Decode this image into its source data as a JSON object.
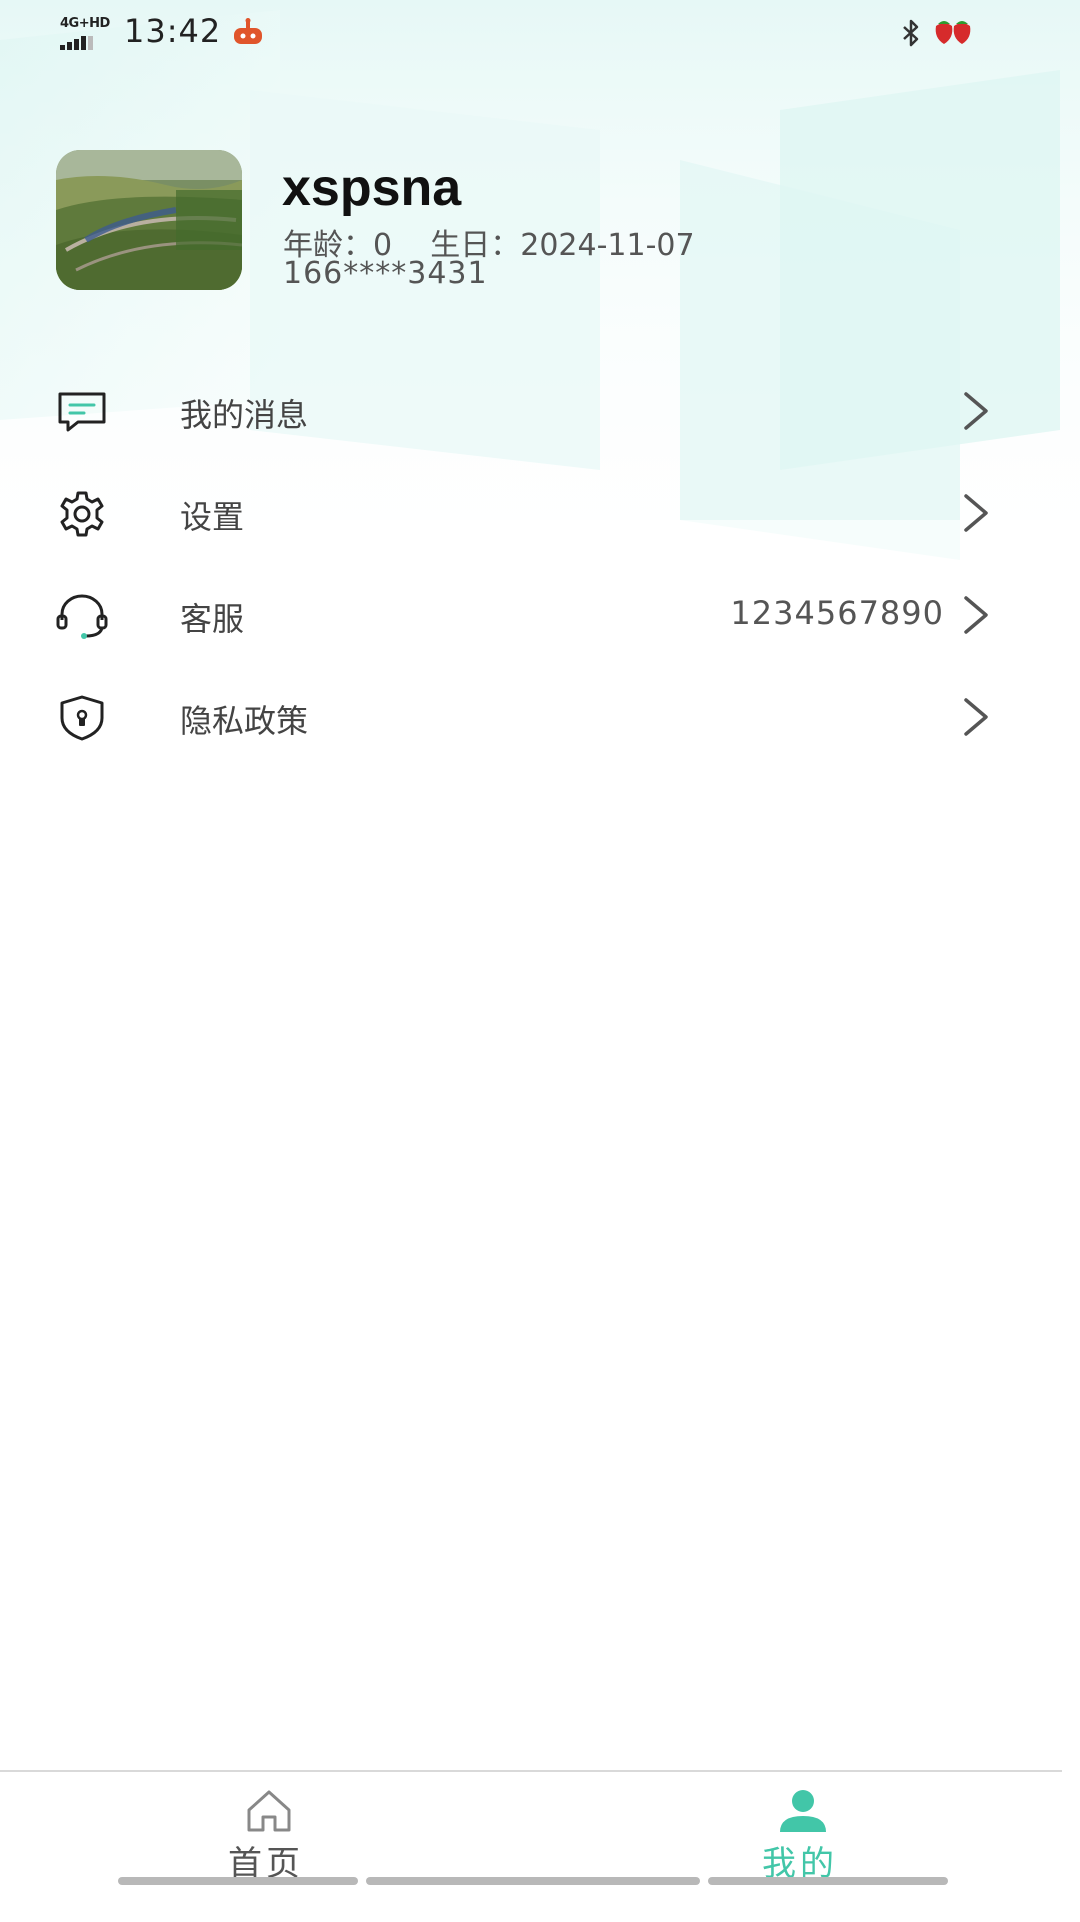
{
  "status_bar": {
    "network": "4G+HD",
    "time": "13:42",
    "app_icon": "robot-icon",
    "bluetooth_icon": "bluetooth-icon",
    "battery_icon": "strawberry-battery-icon"
  },
  "profile": {
    "avatar": "landscape-photo",
    "username": "xspsna",
    "age_label": "年龄：",
    "age_value": "0",
    "birthday_label": "生日：",
    "birthday_value": "2024-11-07",
    "phone": "166****3431"
  },
  "menu": {
    "items": [
      {
        "label": "我的消息",
        "icon": "message-icon",
        "value": ""
      },
      {
        "label": "设置",
        "icon": "gear-icon",
        "value": ""
      },
      {
        "label": "客服",
        "icon": "headset-icon",
        "value": "1234567890"
      },
      {
        "label": "隐私政策",
        "icon": "shield-icon",
        "value": ""
      }
    ]
  },
  "bottom_nav": {
    "items": [
      {
        "label": "首页",
        "icon": "home-icon",
        "active": false
      },
      {
        "label": "我的",
        "icon": "user-icon",
        "active": true
      }
    ]
  },
  "colors": {
    "accent": "#42c6a8",
    "header_tint": "#e6f8f6",
    "text_primary": "#111111",
    "text_secondary": "#555555"
  }
}
